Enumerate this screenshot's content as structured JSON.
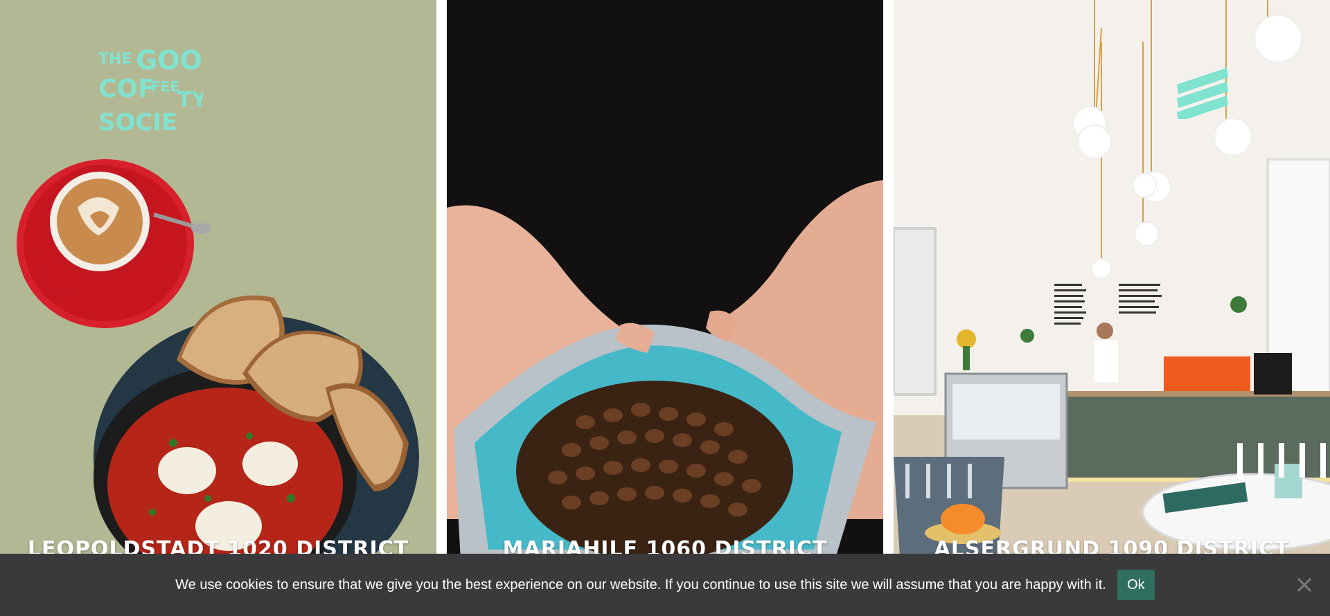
{
  "brand": {
    "logo_text": "THE GOOD COFFEE SOCIETY",
    "accent_color": "#7fe3d0"
  },
  "panels": [
    {
      "district": "LEOPOLDSTADT 1020 DISTRICT",
      "image": "coffee cup with shakshuka and bread"
    },
    {
      "district": "MARIAHILF 1060 DISTRICT",
      "image": "hands holding bag of coffee beans"
    },
    {
      "district": "ALSERGRUND 1090 DISTRICT",
      "image": "cafe interior with barista"
    }
  ],
  "menu": {
    "icon": "menu-icon"
  },
  "cookie": {
    "message": "We use cookies to ensure that we give you the best experience on our website. If you continue to use this site we will assume that you are happy with it.",
    "ok_label": "Ok",
    "close_icon": "close-icon",
    "bar_color": "#3a3a3c",
    "button_color": "#2f6f5d"
  }
}
